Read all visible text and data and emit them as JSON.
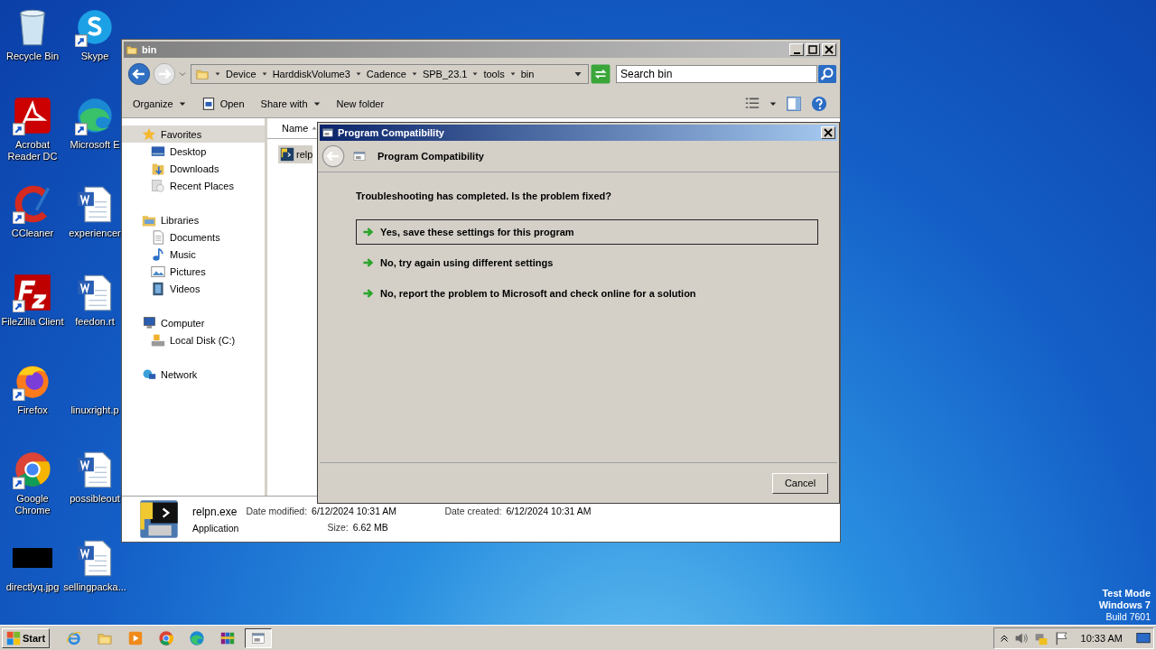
{
  "desktop_icons": [
    {
      "label": "Recycle Bin",
      "kind": "recycle"
    },
    {
      "label": "Skype",
      "kind": "skype",
      "shortcut": true
    },
    {
      "label": "Acrobat Reader DC",
      "kind": "acrobat",
      "shortcut": true
    },
    {
      "label": "Microsoft E",
      "kind": "edge",
      "shortcut": true
    },
    {
      "label": "CCleaner",
      "kind": "ccleaner",
      "shortcut": true
    },
    {
      "label": "experiencer",
      "kind": "word"
    },
    {
      "label": "FileZilla Client",
      "kind": "filezilla",
      "shortcut": true
    },
    {
      "label": "feedon.rt",
      "kind": "word"
    },
    {
      "label": "Firefox",
      "kind": "firefox",
      "shortcut": true
    },
    {
      "label": "linuxright.p",
      "kind": "blank"
    },
    {
      "label": "Google Chrome",
      "kind": "chrome",
      "shortcut": true
    },
    {
      "label": "possibleout",
      "kind": "word"
    },
    {
      "label": "directlyq.jpg",
      "kind": "image"
    },
    {
      "label": "sellingpacka...",
      "kind": "word"
    }
  ],
  "explorer": {
    "title": "bin",
    "breadcrumb": [
      "Device",
      "HarddiskVolume3",
      "Cadence",
      "SPB_23.1",
      "tools",
      "bin"
    ],
    "search": {
      "placeholder": "Search bin"
    },
    "toolbar": [
      {
        "label": "Organize",
        "kind": "menu"
      },
      {
        "label": "Open",
        "kind": "open"
      },
      {
        "label": "Share with",
        "kind": "menu"
      },
      {
        "label": "New folder",
        "kind": "plain"
      }
    ],
    "nav": [
      {
        "label": "Favorites",
        "kind": "star",
        "selected": true,
        "children": [
          {
            "label": "Desktop",
            "kind": "desktop"
          },
          {
            "label": "Downloads",
            "kind": "downloads"
          },
          {
            "label": "Recent Places",
            "kind": "recent"
          }
        ]
      },
      {
        "label": "Libraries",
        "kind": "libraries",
        "selected": false,
        "children": [
          {
            "label": "Documents",
            "kind": "documents"
          },
          {
            "label": "Music",
            "kind": "music"
          },
          {
            "label": "Pictures",
            "kind": "pictures"
          },
          {
            "label": "Videos",
            "kind": "videos"
          }
        ]
      },
      {
        "label": "Computer",
        "kind": "computer",
        "selected": false,
        "children": [
          {
            "label": "Local Disk (C:)",
            "kind": "disk"
          }
        ]
      },
      {
        "label": "Network",
        "kind": "network",
        "selected": false
      }
    ],
    "columns": [
      "Name"
    ],
    "files": [
      {
        "name": "relp",
        "selected": true
      }
    ],
    "details": {
      "name": "relpn.exe",
      "type": "Application",
      "fields": [
        {
          "label": "Date modified:",
          "value": "6/12/2024 10:31 AM"
        },
        {
          "label": "Date created:",
          "value": "6/12/2024 10:31 AM"
        },
        {
          "label": "Size:",
          "value": "6.62 MB"
        }
      ]
    }
  },
  "dialog": {
    "title": "Program Compatibility",
    "header": "Program Compatibility",
    "question": "Troubleshooting has completed.  Is the problem fixed?",
    "options": [
      {
        "label": "Yes, save these settings for this program",
        "selected": true
      },
      {
        "label": "No, try again using different settings",
        "selected": false
      },
      {
        "label": "No, report the problem to Microsoft and check online for a solution",
        "selected": false
      }
    ],
    "buttons": [
      "Cancel"
    ]
  },
  "taskbar": {
    "start": "Start",
    "apps": [
      {
        "kind": "ie",
        "active": false
      },
      {
        "kind": "folder",
        "active": false
      },
      {
        "kind": "media",
        "active": false
      },
      {
        "kind": "chrome",
        "active": false
      },
      {
        "kind": "edge",
        "active": false
      },
      {
        "kind": "winrar",
        "active": false
      },
      {
        "kind": "compat",
        "active": true
      }
    ],
    "time": "10:33 AM"
  },
  "watermark_text": [
    "Test Mode",
    "Windows 7",
    "Build 7601"
  ]
}
